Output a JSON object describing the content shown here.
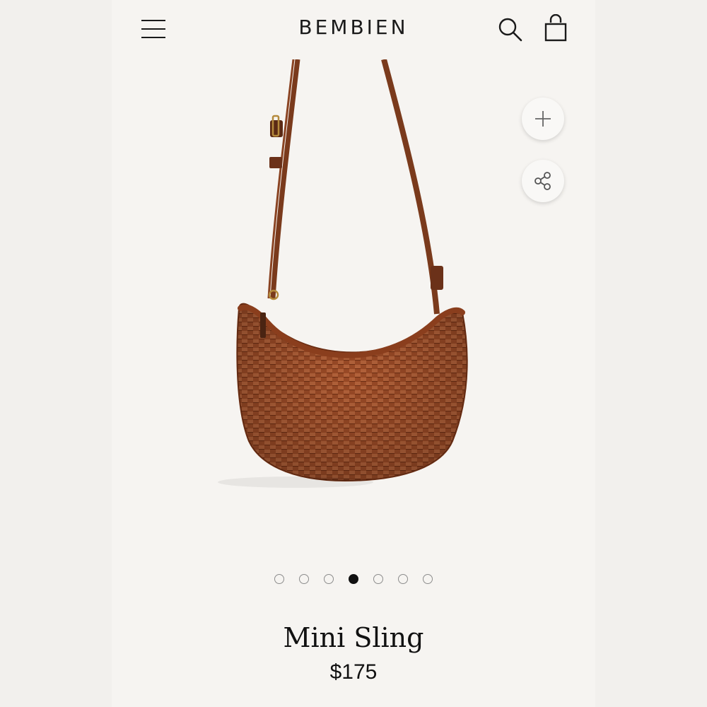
{
  "header": {
    "brand": "BEMBIEN",
    "menu_icon": "hamburger-menu-icon",
    "search_icon": "search-icon",
    "bag_icon": "shopping-bag-icon"
  },
  "product_image": {
    "subject": "woven leather crescent crossbody bag",
    "bag_color": "#9a4a26",
    "strap_color": "#7a3a1c"
  },
  "actions": {
    "zoom_icon": "plus-icon",
    "share_icon": "share-icon"
  },
  "carousel": {
    "total": 7,
    "active_index": 3
  },
  "product": {
    "name": "Mini Sling",
    "price": "$175"
  }
}
